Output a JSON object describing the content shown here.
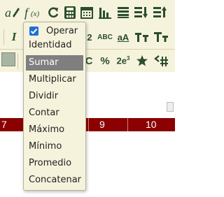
{
  "toolbar": {
    "row1_icons": [
      "text-style-icon",
      "function-icon",
      "refresh-icon",
      "calculator-icon",
      "calendar-icon",
      "bar-chart-icon",
      "align-icon",
      "sort-desc-icon",
      "sort-asc-icon"
    ],
    "row2": {
      "italic": "I",
      "superscript_two": "2",
      "abc": "ABC",
      "case": "aA",
      "percent": "%",
      "exponent": "2e",
      "exponent_sup": "3",
      "c": "C"
    }
  },
  "dropdown": {
    "checkbox_label": "Operar",
    "checkbox_checked": true,
    "items": [
      "Identidad",
      "Sumar",
      "Multiplicar",
      "Dividir",
      "Contar",
      "Máximo",
      "Mínimo",
      "Promedio",
      "Concatenar"
    ],
    "selected": "Sumar"
  },
  "grid": {
    "columns": [
      "7",
      "9",
      "10"
    ]
  },
  "colors": {
    "toolbar_bg": "#f6f3dc",
    "header_bg": "#8b0000",
    "icon_green": "#2a4d2f",
    "selected_item_bg": "#7f7f7f",
    "checkbox_blue": "#1f6fd6"
  }
}
